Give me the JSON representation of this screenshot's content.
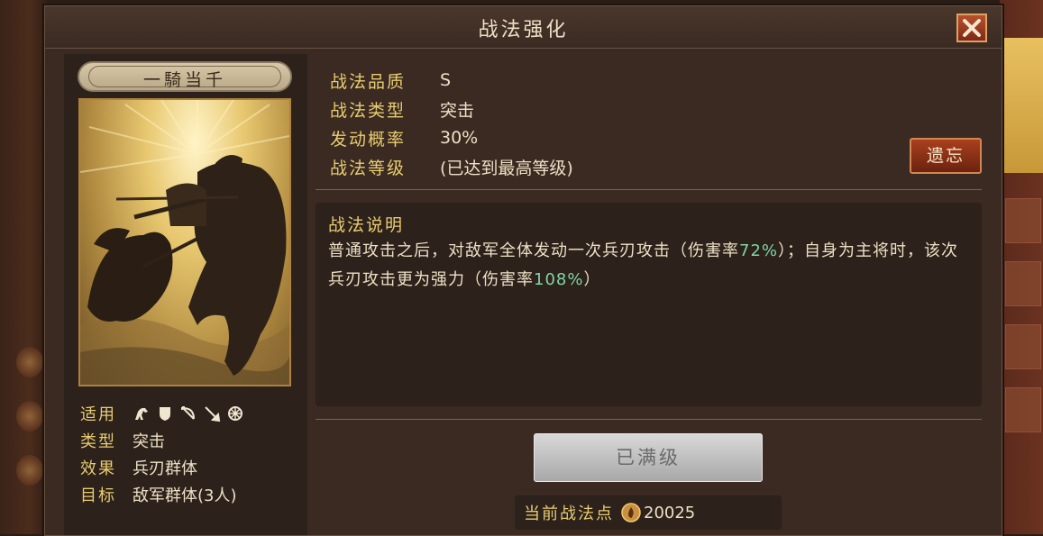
{
  "dialog": {
    "title": "战法强化"
  },
  "card": {
    "name": "一騎当千",
    "attributes": {
      "applicable_label": "适用",
      "applicable_troops": [
        "cavalry-icon",
        "shield-icon",
        "bow-icon",
        "spear-icon",
        "wheel-icon"
      ],
      "type_label": "类型",
      "type_value": "突击",
      "effect_label": "效果",
      "effect_value": "兵刃群体",
      "target_label": "目标",
      "target_value": "敌军群体(3人)"
    }
  },
  "info": {
    "quality_label": "战法品质",
    "quality_value": "S",
    "type_label": "战法类型",
    "type_value": "突击",
    "rate_label": "发动概率",
    "rate_value": "30%",
    "level_label": "战法等级",
    "level_value": "(已达到最高等级)"
  },
  "forget_button": "遗忘",
  "description": {
    "title": "战法说明",
    "part1": "普通攻击之后，对敌军全体发动一次兵刃攻击（伤害率",
    "value1": "72%",
    "part2": "）；自身为主将时，该次兵刃攻击更为强力（伤害率",
    "value2": "108%",
    "part3": "）"
  },
  "maxed_button": "已满级",
  "points": {
    "label": "当前战法点",
    "value": "20025"
  },
  "colors": {
    "gold_label": "#e8cc70",
    "highlight": "#7fd6a8",
    "panel": "#3a2a22"
  }
}
